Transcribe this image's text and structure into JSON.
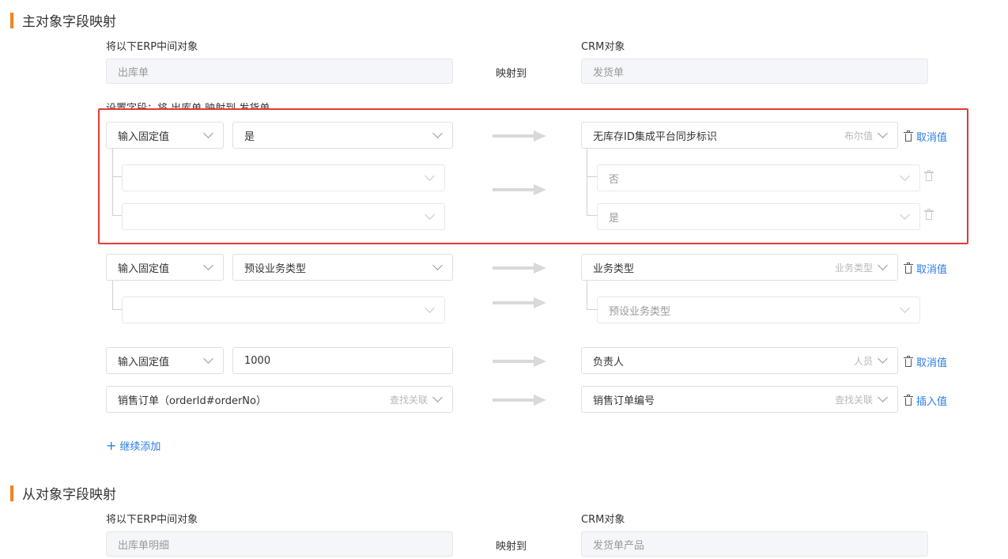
{
  "main_section": {
    "title": "主对象字段映射",
    "erp_label": "将以下ERP中间对象",
    "crm_label": "CRM对象",
    "erp_value": "出库单",
    "map_to": "映射到",
    "crm_value": "发货单",
    "setting_label": "设置字段：将 出库单 映射到 发货单"
  },
  "rows": [
    {
      "left_type": "输入固定值",
      "left_value": "是",
      "right_field": "无库存ID集成平台同步标识",
      "right_hint": "布尔值",
      "action": "取消值",
      "sub": [
        {
          "left": "",
          "right": "否"
        },
        {
          "left": "",
          "right": "是"
        }
      ]
    },
    {
      "left_type": "输入固定值",
      "left_value": "预设业务类型",
      "right_field": "业务类型",
      "right_hint": "业务类型",
      "action": "取消值",
      "sub": [
        {
          "left": "",
          "right": "预设业务类型"
        }
      ]
    },
    {
      "left_type": "输入固定值",
      "left_value": "1000",
      "right_field": "负责人",
      "right_hint": "人员",
      "action": "取消值"
    },
    {
      "left_value": "销售订单（orderId#orderNo）",
      "left_hint": "查找关联",
      "right_field": "销售订单编号",
      "right_hint": "查找关联",
      "action": "插入值"
    }
  ],
  "continue_add": "继续添加",
  "detail_section": {
    "title": "从对象字段映射",
    "erp_label": "将以下ERP中间对象",
    "crm_label": "CRM对象",
    "erp_value": "出库单明细",
    "map_to": "映射到",
    "crm_value": "发货单产品"
  },
  "colors": {
    "accent": "#f5821f",
    "link": "#2b7de9",
    "highlight": "#e53935"
  }
}
